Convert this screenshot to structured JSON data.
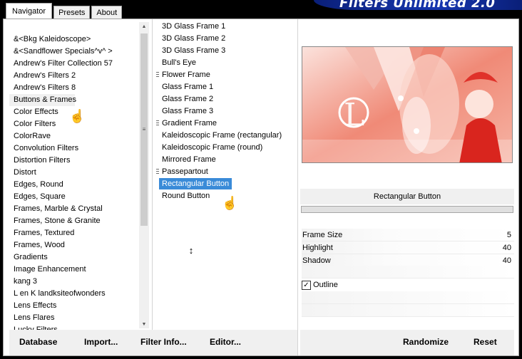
{
  "tabs": [
    {
      "label": "Navigator",
      "active": true
    },
    {
      "label": "Presets",
      "active": false
    },
    {
      "label": "About",
      "active": false
    }
  ],
  "banner_title": "Filters Unlimited 2.0",
  "categories": [
    "&<Bkg Kaleidoscope>",
    "&<Sandflower Specials^v^ >",
    "Andrew's Filter Collection 57",
    "Andrew's Filters 2",
    "Andrew's Filters 8",
    "Buttons & Frames",
    "Color Effects",
    "Color Filters",
    "ColorRave",
    "Convolution Filters",
    "Distortion Filters",
    "Distort",
    "Edges, Round",
    "Edges, Square",
    "Frames, Marble & Crystal",
    "Frames, Stone & Granite",
    "Frames, Textured",
    "Frames, Wood",
    "Gradients",
    "Image Enhancement",
    "kang 3",
    "L en K landksiteofwonders",
    "Lens Effects",
    "Lens Flares",
    "Lucky Filters"
  ],
  "selected_category": "Buttons & Frames",
  "filters": [
    {
      "label": "3D Glass Frame 1",
      "group": false
    },
    {
      "label": "3D Glass Frame 2",
      "group": false
    },
    {
      "label": "3D Glass Frame 3",
      "group": false
    },
    {
      "label": "Bull's Eye",
      "group": false
    },
    {
      "label": "Flower Frame",
      "group": true
    },
    {
      "label": "Glass Frame 1",
      "group": false
    },
    {
      "label": "Glass Frame 2",
      "group": false
    },
    {
      "label": "Glass Frame 3",
      "group": false
    },
    {
      "label": "Gradient Frame",
      "group": true
    },
    {
      "label": "Kaleidoscopic Frame (rectangular)",
      "group": false
    },
    {
      "label": "Kaleidoscopic Frame (round)",
      "group": false
    },
    {
      "label": "Mirrored Frame",
      "group": false
    },
    {
      "label": "Passepartout",
      "group": true
    },
    {
      "label": "Rectangular Button",
      "group": false
    },
    {
      "label": "Round Button",
      "group": false
    }
  ],
  "selected_filter": "Rectangular Button",
  "preview": {
    "filter_name": "Rectangular Button"
  },
  "params": [
    {
      "label": "Frame Size",
      "value": "5"
    },
    {
      "label": "Highlight",
      "value": "40"
    },
    {
      "label": "Shadow",
      "value": "40"
    }
  ],
  "outline": {
    "label": "Outline",
    "checked": true
  },
  "buttons": {
    "database": "Database",
    "import": "Import...",
    "filter_info": "Filter Info...",
    "editor": "Editor...",
    "randomize": "Randomize",
    "reset": "Reset"
  },
  "colors": {
    "selection": "#3a8bd8",
    "banner": "#1636b0",
    "panel_bg": "#f0f0f0"
  }
}
